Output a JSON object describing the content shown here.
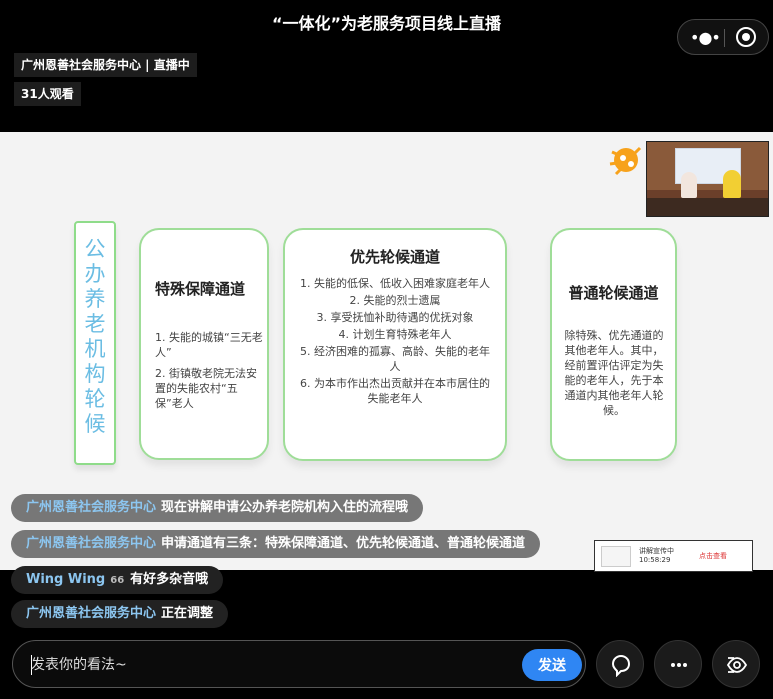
{
  "header": {
    "title": "“一体化”为老服务项目线上直播",
    "host_tag": "广州恩善社会服务中心 | 直播中",
    "viewer_count": "31人观看"
  },
  "slide": {
    "vertical_title": "公办养老机构轮候",
    "special": {
      "title": "特殊保障通道",
      "items": [
        "1. 失能的城镇“三无老人”",
        "2. 街镇敬老院无法安置的失能农村“五保”老人"
      ]
    },
    "priority": {
      "title": "优先轮候通道",
      "items": [
        "1. 失能的低保、低收入困难家庭老年人",
        "2. 失能的烈士遗属",
        "3. 享受抚恤补助待遇的优抚对象",
        "4. 计划生育特殊老年人",
        "5. 经济困难的孤寡、高龄、失能的老年人",
        "6. 为本市作出杰出贡献并在本市居住的失能老年人"
      ]
    },
    "normal": {
      "title": "普通轮候通道",
      "body": "除特殊、优先通道的其他老年人。其中，经前置评估评定为失能的老年人，先于本通道内其他老年人轮候。"
    }
  },
  "chat": [
    {
      "user": "广州恩善社会服务中心",
      "badge": "",
      "text": "现在讲解申请公办养老院机构入住的流程哦"
    },
    {
      "user": "广州恩善社会服务中心",
      "badge": "",
      "text": "申请通道有三条：特殊保障通道、优先轮候通道、普通轮候通道"
    },
    {
      "user": "Wing Wing",
      "badge": "66",
      "text": "有好多杂音哦"
    },
    {
      "user": "广州恩善社会服务中心",
      "badge": "",
      "text": "正在调整"
    }
  ],
  "mini_card": {
    "line1": "讲解宣传中",
    "line2": "10:58:29",
    "link": "点击查看"
  },
  "composer": {
    "placeholder": "发表你的看法~",
    "send_label": "发送"
  },
  "icons": {
    "menu": "more-dots-icon",
    "close": "target-circle-icon",
    "comment": "comment-bubble-icon",
    "more": "ellipsis-icon",
    "eye": "eye-view-icon"
  },
  "colors": {
    "accent": "#2f86f3",
    "card_border": "#9fdd98",
    "vertical_text": "#6bbde3",
    "chat_user": "#8cc6f0"
  }
}
